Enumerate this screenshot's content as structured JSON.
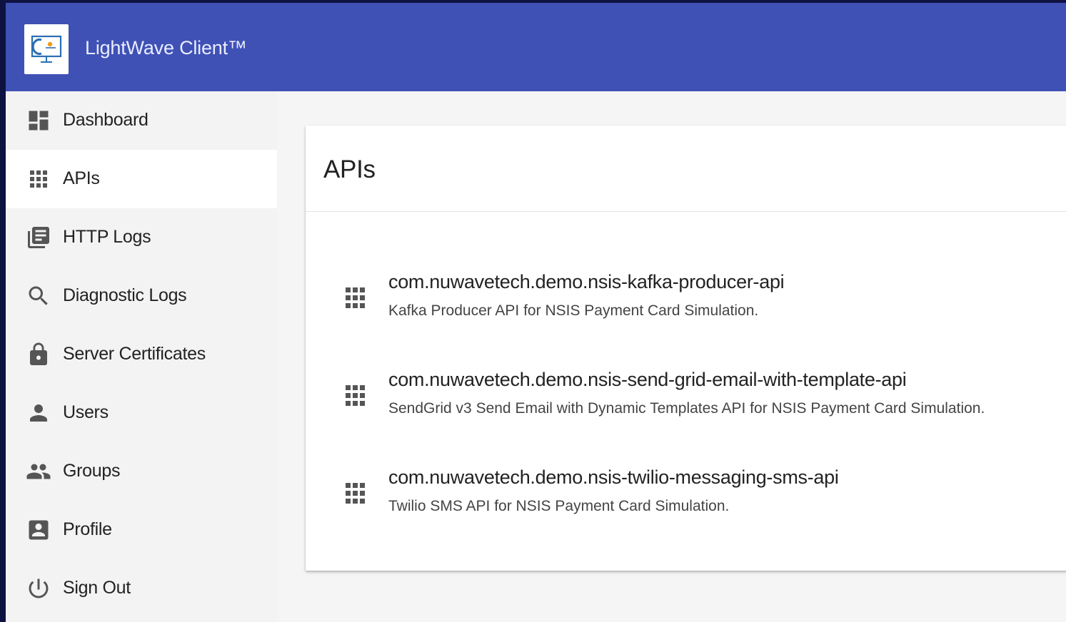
{
  "app": {
    "title": "LightWave Client™",
    "logo_icon": "monitor-logo-icon",
    "accent_color": "#3f51b5"
  },
  "sidebar": {
    "items": [
      {
        "label": "Dashboard",
        "icon": "dashboard-icon",
        "active": false
      },
      {
        "label": "APIs",
        "icon": "apps-grid-icon",
        "active": true
      },
      {
        "label": "HTTP Logs",
        "icon": "library-books-icon",
        "active": false
      },
      {
        "label": "Diagnostic Logs",
        "icon": "search-icon",
        "active": false
      },
      {
        "label": "Server Certificates",
        "icon": "lock-icon",
        "active": false
      },
      {
        "label": "Users",
        "icon": "person-icon",
        "active": false
      },
      {
        "label": "Groups",
        "icon": "people-icon",
        "active": false
      },
      {
        "label": "Profile",
        "icon": "account-box-icon",
        "active": false
      },
      {
        "label": "Sign Out",
        "icon": "power-icon",
        "active": false
      }
    ]
  },
  "main": {
    "card_title": "APIs",
    "apis": [
      {
        "name": "com.nuwavetech.demo.nsis-kafka-producer-api",
        "description": "Kafka Producer API for NSIS Payment Card Simulation.",
        "icon": "apps-grid-icon"
      },
      {
        "name": "com.nuwavetech.demo.nsis-send-grid-email-with-template-api",
        "description": "SendGrid v3 Send Email with Dynamic Templates API for NSIS Payment Card Simulation.",
        "icon": "apps-grid-icon"
      },
      {
        "name": "com.nuwavetech.demo.nsis-twilio-messaging-sms-api",
        "description": "Twilio SMS API for NSIS Payment Card Simulation.",
        "icon": "apps-grid-icon"
      }
    ]
  }
}
